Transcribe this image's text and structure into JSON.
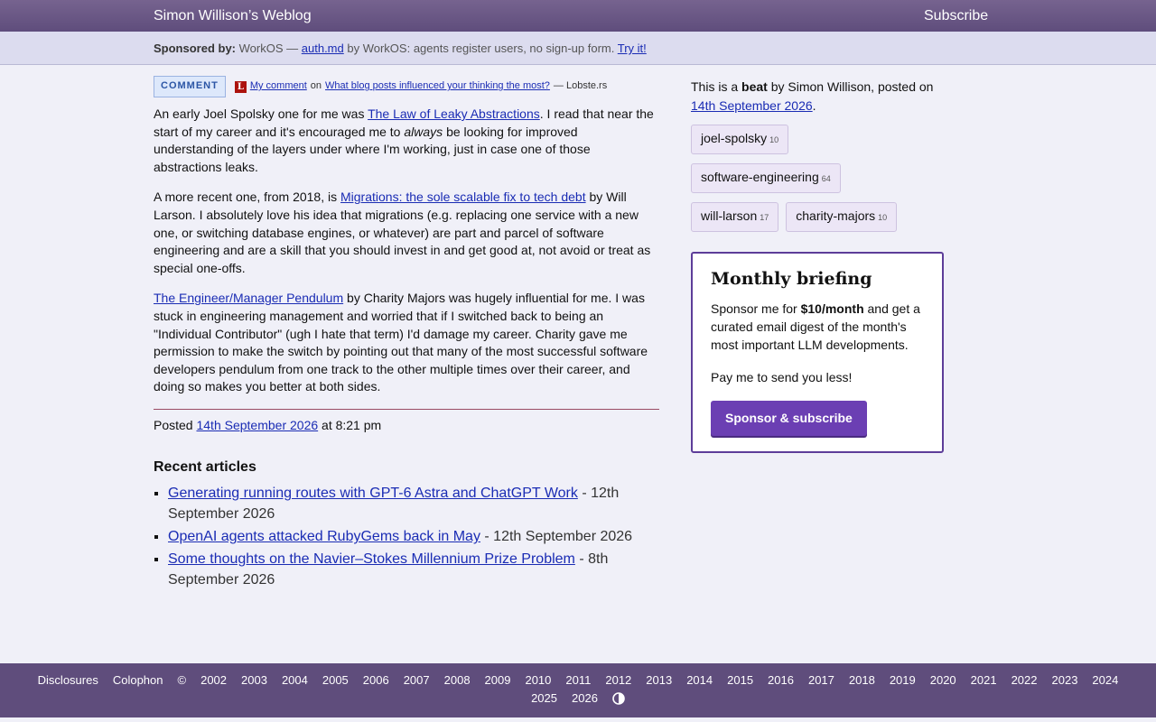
{
  "header": {
    "site_title": "Simon Willison’s Weblog",
    "subscribe": "Subscribe"
  },
  "sponsor": {
    "label": "Sponsored by:",
    "prefix": "WorkOS —",
    "link": "auth.md",
    "middle": "by WorkOS: agents register users, no sign-up form.",
    "cta": "Try it!"
  },
  "meta": {
    "badge": "COMMENT",
    "lobsters_letter": "L",
    "my_comment": "My comment",
    "on": "on",
    "thread_link": "What blog posts influenced your thinking the most?",
    "source": "— Lobste.rs"
  },
  "body": {
    "p1_a": "An early Joel Spolsky one for me was",
    "p1_link": "The Law of Leaky Abstractions",
    "p1_b": ". I read that near the start of my career and it's encouraged me to",
    "p1_em": "always",
    "p1_c": "be looking for improved understanding of the layers under where I'm working, just in case one of those abstractions leaks.",
    "p2_a": "A more recent one, from 2018, is",
    "p2_link": "Migrations: the sole scalable fix to tech debt",
    "p2_b": "by Will Larson. I absolutely love his idea that migrations (e.g. replacing one service with a new one, or switching database engines, or whatever) are part and parcel of software engineering and are a skill that you should invest in and get good at, not avoid or treat as special one-offs.",
    "p3_link": "The Engineer/Manager Pendulum",
    "p3_b": "by Charity Majors was hugely influential for me. I was stuck in engineering management and worried that if I switched back to being an \"Individual Contributor\" (ugh I hate that term) I'd damage my career. Charity gave me permission to make the switch by pointing out that many of the most successful software developers pendulum from one track to the other multiple times over their career, and doing so makes you better at both sides."
  },
  "posted": {
    "label": "Posted",
    "date": "14th September 2026",
    "time": "at 8:21 pm"
  },
  "recent": {
    "heading": "Recent articles",
    "items": [
      {
        "title": "Generating running routes with GPT-6 Astra and ChatGPT Work",
        "date": "- 12th September 2026"
      },
      {
        "title": "OpenAI agents attacked RubyGems back in May",
        "date": "- 12th September 2026"
      },
      {
        "title": "Some thoughts on the Navier–Stokes Millennium Prize Problem",
        "date": "- 8th September 2026"
      }
    ]
  },
  "sidebar": {
    "intro_a": "This is a",
    "intro_b": "beat",
    "intro_c": "by Simon Willison, posted on",
    "intro_date": "14th September 2026",
    "intro_end": ".",
    "tags": [
      {
        "name": "joel-spolsky",
        "count": "10"
      },
      {
        "name": "software-engineering",
        "count": "64"
      },
      {
        "name": "will-larson",
        "count": "17"
      },
      {
        "name": "charity-majors",
        "count": "10"
      }
    ]
  },
  "briefing": {
    "title": "Monthly briefing",
    "text_a": "Sponsor me for",
    "price": "$10/month",
    "text_b": "and get a curated email digest of the month's most important LLM developments.",
    "text2": "Pay me to send you less!",
    "button": "Sponsor & subscribe"
  },
  "footer": {
    "disclosures": "Disclosures",
    "colophon": "Colophon",
    "copyright": "©",
    "years": [
      "2002",
      "2003",
      "2004",
      "2005",
      "2006",
      "2007",
      "2008",
      "2009",
      "2010",
      "2011",
      "2012",
      "2013",
      "2014",
      "2015",
      "2016",
      "2017",
      "2018",
      "2019",
      "2020",
      "2021",
      "2022",
      "2023",
      "2024",
      "2025",
      "2026"
    ]
  },
  "colors": {
    "header": "#5f4d7c",
    "link": "#1a2cb4",
    "accent": "#6b3fb3"
  }
}
